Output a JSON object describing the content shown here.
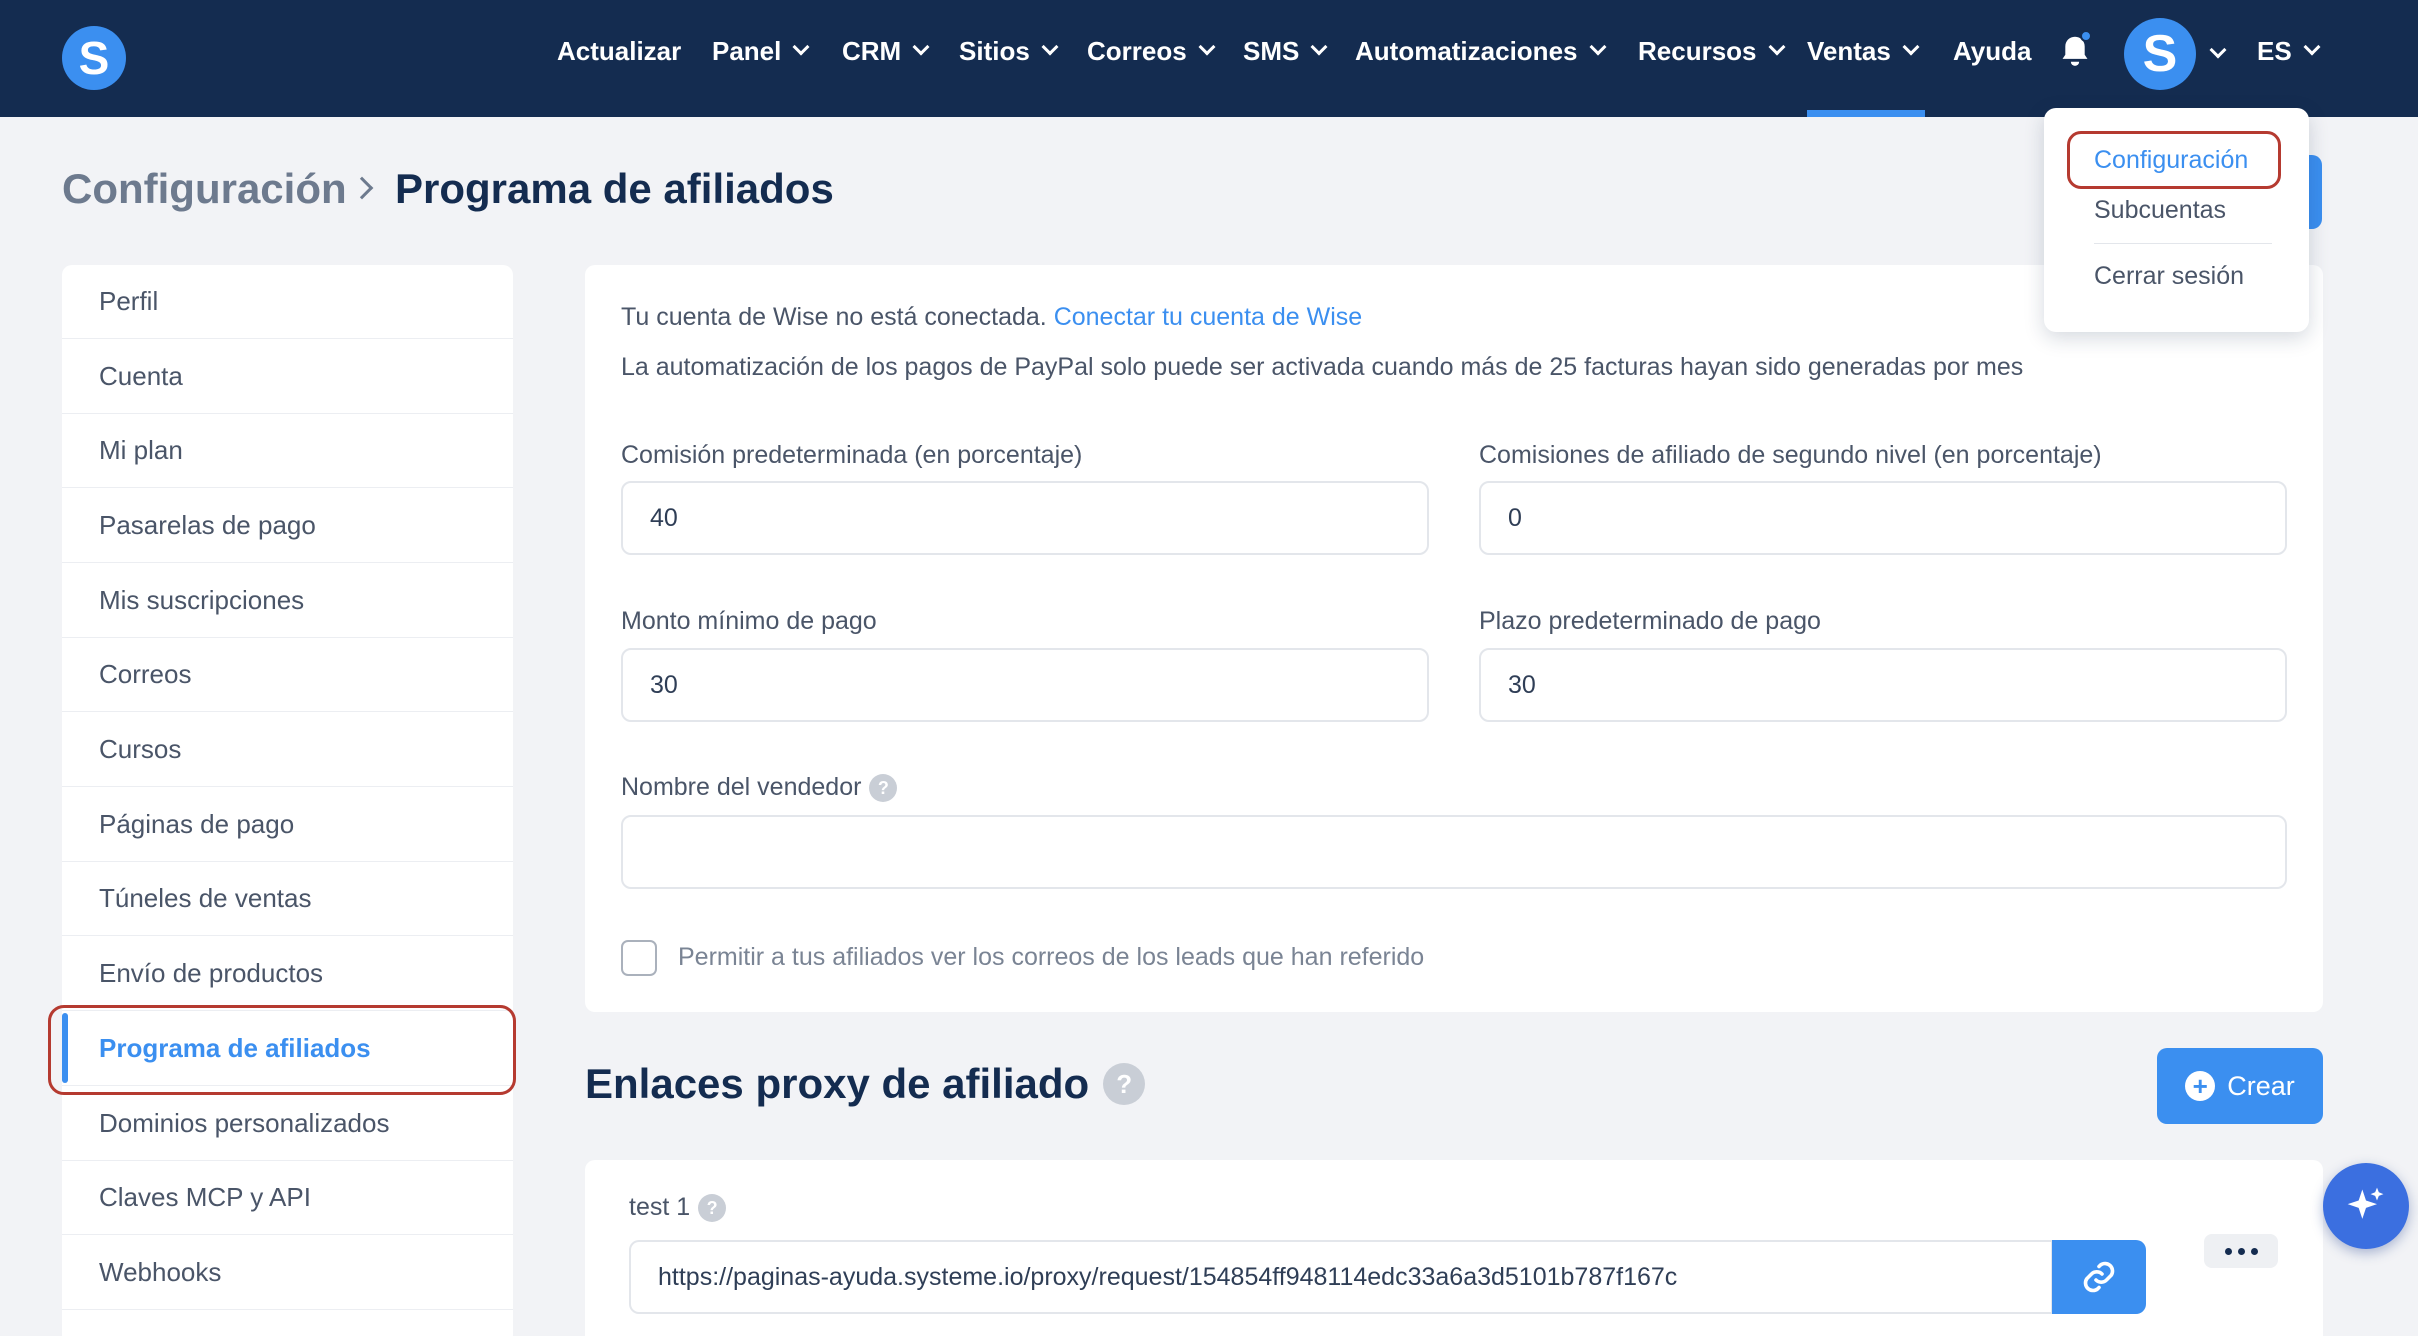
{
  "app": {
    "logo_letter": "S"
  },
  "nav": {
    "items": [
      {
        "label": "Actualizar",
        "dropdown": false
      },
      {
        "label": "Panel",
        "dropdown": true
      },
      {
        "label": "CRM",
        "dropdown": true
      },
      {
        "label": "Sitios",
        "dropdown": true
      },
      {
        "label": "Correos",
        "dropdown": true
      },
      {
        "label": "SMS",
        "dropdown": true
      },
      {
        "label": "Automatizaciones",
        "dropdown": true
      },
      {
        "label": "Recursos",
        "dropdown": true
      },
      {
        "label": "Ventas",
        "dropdown": true,
        "active": true
      },
      {
        "label": "Ayuda",
        "dropdown": false
      }
    ],
    "avatar_letter": "S",
    "language": "ES",
    "notification_unread": true
  },
  "user_menu": {
    "items": [
      {
        "label": "Configuración",
        "active": true
      },
      {
        "label": "Subcuentas"
      },
      {
        "label": "Cerrar sesión"
      }
    ]
  },
  "breadcrumb": {
    "parent": "Configuración",
    "current": "Programa de afiliados"
  },
  "sidebar": {
    "items": [
      {
        "label": "Perfil"
      },
      {
        "label": "Cuenta"
      },
      {
        "label": "Mi plan"
      },
      {
        "label": "Pasarelas de pago"
      },
      {
        "label": "Mis suscripciones"
      },
      {
        "label": "Correos"
      },
      {
        "label": "Cursos"
      },
      {
        "label": "Páginas de pago"
      },
      {
        "label": "Túneles de ventas"
      },
      {
        "label": "Envío de productos"
      },
      {
        "label": "Programa de afiliados",
        "active": true
      },
      {
        "label": "Dominios personalizados"
      },
      {
        "label": "Claves MCP y API"
      },
      {
        "label": "Webhooks"
      }
    ]
  },
  "settings": {
    "wise_status": "Tu cuenta de Wise no está conectada.",
    "wise_link": "Conectar tu cuenta de Wise",
    "paypal_note": "La automatización de los pagos de PayPal solo puede ser activada cuando más de 25 facturas hayan sido generadas por mes",
    "default_commission": {
      "label": "Comisión predeterminada (en porcentaje)",
      "value": "40"
    },
    "second_level_commission": {
      "label": "Comisiones de afiliado de segundo nivel (en porcentaje)",
      "value": "0"
    },
    "min_payout": {
      "label": "Monto mínimo de pago",
      "value": "30"
    },
    "payout_term": {
      "label": "Plazo predeterminado de pago",
      "value": "30"
    },
    "seller_name": {
      "label": "Nombre del vendedor",
      "value": ""
    },
    "help_glyph": "?",
    "allow_emails": {
      "label": "Permitir a tus afiliados ver los correos de los leads que han referido",
      "checked": false
    }
  },
  "proxy_links": {
    "title": "Enlaces proxy de afiliado",
    "create_label": "Crear",
    "items": [
      {
        "name": "test 1",
        "url": "https://paginas-ayuda.systeme.io/proxy/request/154854ff948114edc33a6a3d5101b787f167c"
      }
    ]
  },
  "colors": {
    "nav_bg": "#142c50",
    "accent": "#3b8ff0",
    "highlight_outline": "#b53a30",
    "page_bg": "#f2f3f6"
  }
}
